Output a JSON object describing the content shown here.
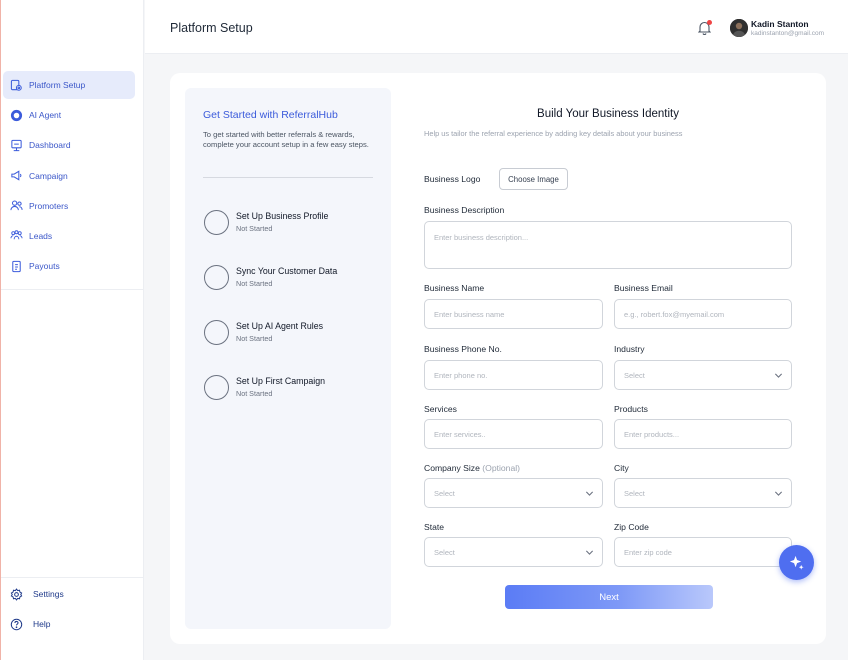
{
  "sidebar": {
    "items": [
      {
        "label": "Platform Setup",
        "icon": "setup-icon",
        "active": true
      },
      {
        "label": "AI Agent",
        "icon": "ai-agent-icon"
      },
      {
        "label": "Dashboard",
        "icon": "dashboard-icon"
      },
      {
        "label": "Campaign",
        "icon": "megaphone-icon"
      },
      {
        "label": "Promoters",
        "icon": "users-icon"
      },
      {
        "label": "Leads",
        "icon": "leads-icon"
      },
      {
        "label": "Payouts",
        "icon": "payouts-icon"
      }
    ],
    "bottom": [
      {
        "label": "Settings",
        "icon": "gear-icon"
      },
      {
        "label": "Help",
        "icon": "help-icon"
      }
    ]
  },
  "header": {
    "title": "Platform Setup",
    "user_name": "Kadin Stanton",
    "user_email": "kadinstanton@gmail.com"
  },
  "steps": {
    "title": "Get Started with ReferralHub",
    "description": "To get started with better referrals & rewards, complete your account setup in a few easy steps.",
    "items": [
      {
        "label": "Set Up Business Profile",
        "status": "Not Started"
      },
      {
        "label": "Sync Your Customer Data",
        "status": "Not Started"
      },
      {
        "label": "Set Up AI Agent Rules",
        "status": "Not Started"
      },
      {
        "label": "Set Up First Campaign",
        "status": "Not Started"
      }
    ]
  },
  "form": {
    "title": "Build Your Business Identity",
    "subtitle": "Help us tailor the referral experience by adding key details about your business",
    "logo_label": "Business Logo",
    "choose_image": "Choose Image",
    "description_label": "Business Description",
    "description_placeholder": "Enter business description...",
    "name_label": "Business Name",
    "name_placeholder": "Enter business name",
    "email_label": "Business Email",
    "email_placeholder": "e.g., robert.fox@myemail.com",
    "phone_label": "Business Phone No.",
    "phone_placeholder": "Enter phone no.",
    "industry_label": "Industry",
    "industry_value": "Select",
    "services_label": "Services",
    "services_placeholder": "Enter services..",
    "products_label": "Products",
    "products_placeholder": "Enter products...",
    "size_label": "Company Size",
    "size_optional": "(Optional)",
    "size_value": "Select",
    "city_label": "City",
    "city_value": "Select",
    "state_label": "State",
    "state_value": "Select",
    "zip_label": "Zip Code",
    "zip_placeholder": "Enter zip code",
    "next_label": "Next"
  },
  "colors": {
    "accent": "#3b5bdb",
    "active_bg": "#e6ebfb",
    "fab": "#4f6ef0"
  }
}
